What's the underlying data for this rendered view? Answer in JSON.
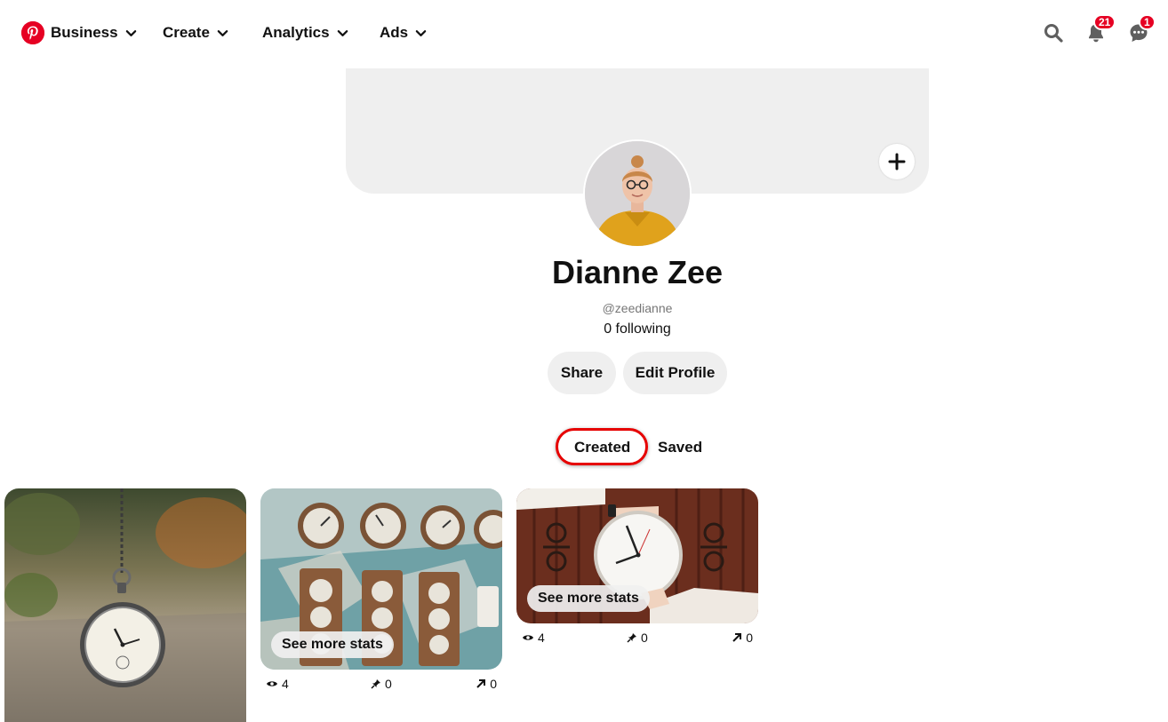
{
  "nav": {
    "brand_color": "#e60023",
    "logo_icon": "pinterest-logo",
    "items": [
      {
        "label": "Business"
      },
      {
        "label": "Create"
      },
      {
        "label": "Analytics"
      },
      {
        "label": "Ads"
      }
    ],
    "notifications_count": "21",
    "messages_count": "1"
  },
  "profile": {
    "name": "Dianne Zee",
    "handle": "@zeedianne",
    "following": "0 following",
    "share_label": "Share",
    "edit_label": "Edit Profile"
  },
  "tabs": {
    "created": "Created",
    "saved": "Saved",
    "active": "Created",
    "highlight_color": "#e60000"
  },
  "pins": [
    {
      "image": "pocket-watch-photo"
    },
    {
      "image": "gauges-wall-photo",
      "stats_label": "See more stats",
      "views": "4",
      "saves": "0",
      "clicks": "0"
    },
    {
      "image": "wall-clock-photo",
      "stats_label": "See more stats",
      "views": "4",
      "saves": "0",
      "clicks": "0"
    }
  ]
}
